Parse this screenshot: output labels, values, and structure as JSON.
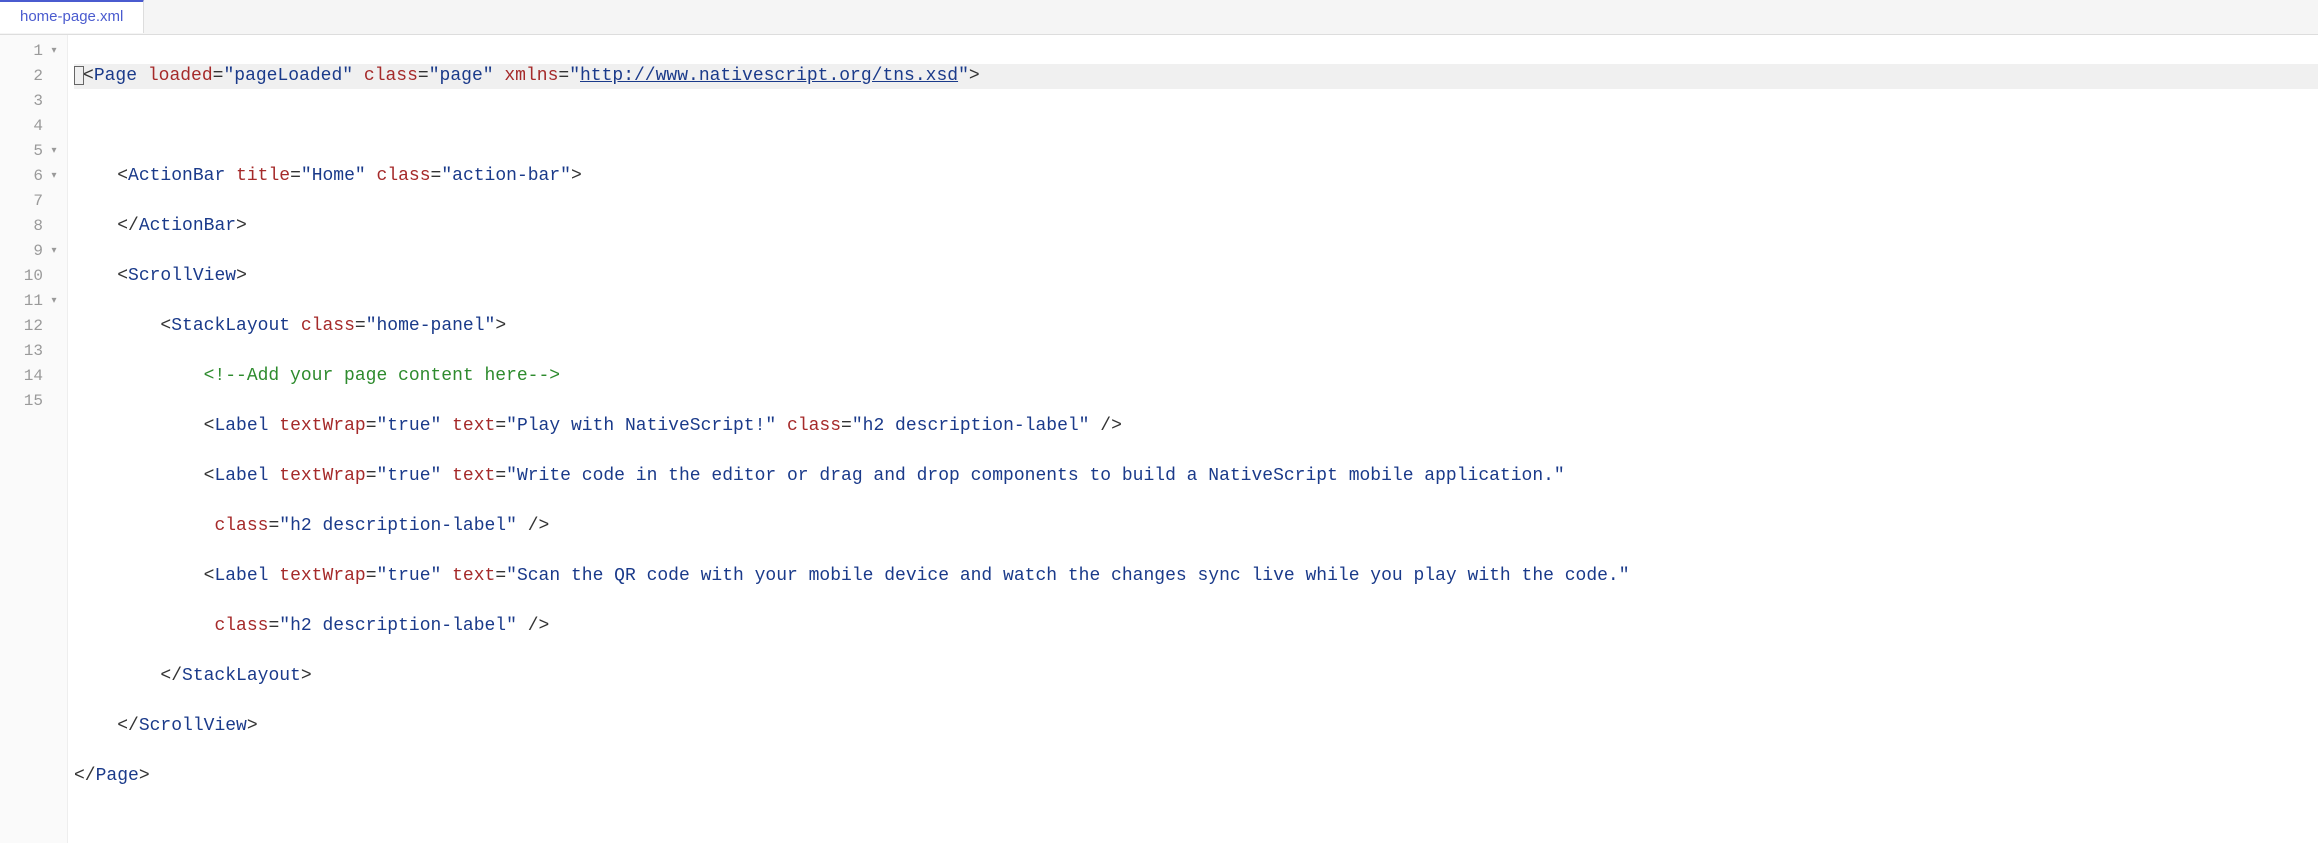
{
  "tab": {
    "filename": "home-page.xml"
  },
  "gutter": {
    "lines": [
      1,
      2,
      3,
      4,
      5,
      6,
      7,
      8,
      9,
      10,
      11,
      12,
      13,
      14,
      15
    ],
    "folds": {
      "1": true,
      "5": true,
      "6": true,
      "9": true,
      "11": true
    }
  },
  "code": {
    "l1": {
      "a_tag": "Page",
      "b_attr1": "loaded",
      "b_val1": "\"pageLoaded\"",
      "c_attr2": "class",
      "c_val2": "\"page\"",
      "d_attr3": "xmlns",
      "d_val3_open": "\"",
      "d_val3_url": "http://www.nativescript.org/tns.xsd",
      "d_val3_close": "\""
    },
    "l3": {
      "tag": "ActionBar",
      "attr1": "title",
      "val1": "\"Home\"",
      "attr2": "class",
      "val2": "\"action-bar\""
    },
    "l4": {
      "tag": "ActionBar"
    },
    "l5": {
      "tag": "ScrollView"
    },
    "l6": {
      "tag": "StackLayout",
      "attr1": "class",
      "val1": "\"home-panel\""
    },
    "l7": {
      "comment": "<!--Add your page content here-->"
    },
    "l8": {
      "tag": "Label",
      "attr1": "textWrap",
      "val1": "\"true\"",
      "attr2": "text",
      "val2": "\"Play with NativeScript!\"",
      "attr3": "class",
      "val3": "\"h2 description-label\""
    },
    "l9": {
      "tag": "Label",
      "attr1": "textWrap",
      "val1": "\"true\"",
      "attr2": "text",
      "val2": "\"Write code in the editor or drag and drop components to build a NativeScript mobile application.\""
    },
    "l10": {
      "attr1": "class",
      "val1": "\"h2 description-label\""
    },
    "l11": {
      "tag": "Label",
      "attr1": "textWrap",
      "val1": "\"true\"",
      "attr2": "text",
      "val2": "\"Scan the QR code with your mobile device and watch the changes sync live while you play with the code.\""
    },
    "l12": {
      "attr1": "class",
      "val1": "\"h2 description-label\""
    },
    "l13": {
      "tag": "StackLayout"
    },
    "l14": {
      "tag": "ScrollView"
    },
    "l15": {
      "tag": "Page"
    }
  }
}
